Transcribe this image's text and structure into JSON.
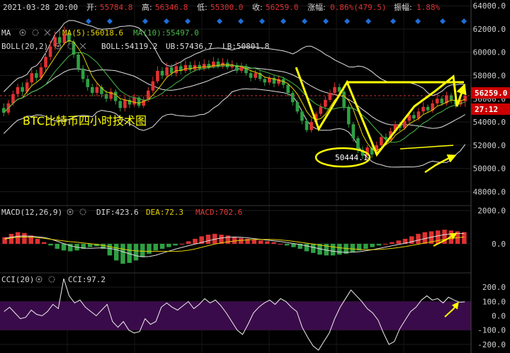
{
  "header": {
    "date": "2021-03-28 20:00",
    "open_label": "开:",
    "open": "55784.8",
    "high_label": "高:",
    "high": "56346.8",
    "low_label": "低:",
    "low": "55300.0",
    "close_label": "收:",
    "close": "56259.0",
    "change_label": "涨幅:",
    "change": "0.86%(479.5)",
    "amp_label": "振幅:",
    "amp": "1.88%"
  },
  "ma_row": {
    "name": "MA",
    "ma5": "MA(5):56018.6",
    "ma10": "MA(10):55497.0"
  },
  "boll_row": {
    "name": "BOLL(20,2)",
    "boll": "BOLL:54119.2",
    "ub": "UB:57436.7",
    "lb": "LB:50801.8"
  },
  "macd_row": {
    "name": "MACD(12,26,9)",
    "dif": "DIF:423.6",
    "dea": "DEA:72.3",
    "macd": "MACD:702.6"
  },
  "cci_row": {
    "name": "CCI(20)",
    "cci": "CCI:97.2"
  },
  "annotation": {
    "title": "BTC比特币四小时技术图",
    "low_bubble": "50444.1"
  },
  "price_tags": {
    "last": "56259.0",
    "countdown": "27:12"
  },
  "colors": {
    "up": "#e03131",
    "down": "#2ea043",
    "ma5": "#e6d200",
    "ma10": "#48b848",
    "boll": "#e0e0e0",
    "yellow": "#ffff00",
    "macd_dea": "#e53935",
    "cci_band": "#3a0b4a",
    "blue_marker": "#1e6fd9",
    "price_tag": "#cc0000"
  },
  "chart_data": [
    {
      "type": "candlestick",
      "panel": "price",
      "y_ticks": [
        "64000.0",
        "62000.0",
        "60000.0",
        "58000.0",
        "56000.0",
        "54000.0",
        "52000.0",
        "50000.0",
        "48000.0"
      ],
      "ylim": [
        46800,
        64500
      ],
      "candles": [
        [
          55200,
          54800,
          55600,
          54500
        ],
        [
          54800,
          55600,
          55900,
          54600
        ],
        [
          55600,
          56400,
          56700,
          55400
        ],
        [
          56400,
          57000,
          57300,
          56100
        ],
        [
          57000,
          56600,
          57400,
          56300
        ],
        [
          56600,
          57400,
          57700,
          56400
        ],
        [
          57400,
          58200,
          58600,
          57100
        ],
        [
          58200,
          57800,
          58500,
          57500
        ],
        [
          57800,
          58700,
          59100,
          57600
        ],
        [
          58700,
          59600,
          60100,
          58400
        ],
        [
          59600,
          60500,
          61000,
          59300
        ],
        [
          60500,
          61300,
          61800,
          60200
        ],
        [
          61300,
          60800,
          61900,
          60500
        ],
        [
          60800,
          61600,
          62200,
          60600
        ],
        [
          61600,
          60900,
          61900,
          60600
        ],
        [
          60900,
          59800,
          61100,
          59500
        ],
        [
          59800,
          58600,
          60000,
          58300
        ],
        [
          58600,
          57700,
          58900,
          57400
        ],
        [
          57700,
          57000,
          58000,
          56700
        ],
        [
          57000,
          56500,
          57300,
          56200
        ],
        [
          56500,
          57000,
          57300,
          56200
        ],
        [
          57000,
          56400,
          57200,
          56100
        ],
        [
          56400,
          56000,
          56700,
          55700
        ],
        [
          56000,
          56600,
          56900,
          55800
        ],
        [
          56600,
          55800,
          56800,
          55500
        ],
        [
          55800,
          55200,
          56000,
          54900
        ],
        [
          55200,
          55900,
          56200,
          54900
        ],
        [
          55900,
          55500,
          56100,
          55200
        ],
        [
          55500,
          56100,
          56400,
          55300
        ],
        [
          56100,
          55400,
          56300,
          55200
        ],
        [
          55400,
          55900,
          56200,
          55200
        ],
        [
          55900,
          56700,
          57000,
          55700
        ],
        [
          56700,
          57500,
          57900,
          56500
        ],
        [
          57500,
          58400,
          58800,
          57300
        ],
        [
          58400,
          58000,
          58700,
          57700
        ],
        [
          58000,
          58700,
          59100,
          57800
        ],
        [
          58700,
          58200,
          59000,
          57900
        ],
        [
          58200,
          58800,
          59200,
          57900
        ],
        [
          58800,
          58400,
          59100,
          58100
        ],
        [
          58400,
          58900,
          59300,
          58200
        ],
        [
          58900,
          58500,
          59200,
          58300
        ],
        [
          58500,
          58900,
          59300,
          58300
        ],
        [
          58900,
          58600,
          59200,
          58400
        ],
        [
          58600,
          59000,
          59400,
          58400
        ],
        [
          59000,
          58700,
          59300,
          58500
        ],
        [
          58700,
          59200,
          59600,
          58600
        ],
        [
          59200,
          58800,
          59500,
          58600
        ],
        [
          58800,
          59100,
          59500,
          58600
        ],
        [
          59100,
          58700,
          59400,
          58500
        ],
        [
          58700,
          58900,
          59300,
          58500
        ],
        [
          58900,
          58400,
          59100,
          58200
        ],
        [
          58400,
          58800,
          59100,
          58200
        ],
        [
          58800,
          58200,
          59000,
          58000
        ],
        [
          58200,
          57800,
          58400,
          57500
        ],
        [
          57800,
          58200,
          58500,
          57600
        ],
        [
          58200,
          57700,
          58400,
          57500
        ],
        [
          57700,
          57400,
          57900,
          57100
        ],
        [
          57400,
          57800,
          58000,
          57200
        ],
        [
          57800,
          57300,
          58000,
          57000
        ],
        [
          57300,
          57700,
          58000,
          57100
        ],
        [
          57700,
          57200,
          57900,
          56900
        ],
        [
          57200,
          56500,
          57300,
          56200
        ],
        [
          56500,
          55700,
          56700,
          55400
        ],
        [
          55700,
          54900,
          55900,
          54700
        ],
        [
          54900,
          54100,
          55000,
          53800
        ],
        [
          54100,
          53300,
          54300,
          53100
        ],
        [
          53300,
          54000,
          54300,
          53100
        ],
        [
          54000,
          54700,
          54900,
          53800
        ],
        [
          54700,
          55300,
          55600,
          54500
        ],
        [
          55300,
          55900,
          56200,
          55100
        ],
        [
          55900,
          56500,
          56800,
          55700
        ],
        [
          56500,
          57000,
          57400,
          56300
        ],
        [
          57000,
          56600,
          57300,
          56400
        ],
        [
          56600,
          55300,
          56800,
          55000
        ],
        [
          55300,
          53800,
          55500,
          53500
        ],
        [
          53800,
          52600,
          54000,
          52300
        ],
        [
          52600,
          51600,
          52800,
          51300
        ],
        [
          51600,
          51100,
          51900,
          50800
        ],
        [
          51100,
          51800,
          52000,
          50600
        ],
        [
          51800,
          51200,
          52100,
          50900
        ],
        [
          51200,
          52000,
          52300,
          51000
        ],
        [
          52000,
          52700,
          53000,
          51800
        ],
        [
          52700,
          52500,
          53000,
          52200
        ],
        [
          52500,
          53200,
          53500,
          52300
        ],
        [
          53200,
          53800,
          54100,
          53000
        ],
        [
          53800,
          53500,
          54000,
          53200
        ],
        [
          53500,
          54100,
          54400,
          53300
        ],
        [
          54100,
          54600,
          54900,
          53900
        ],
        [
          54600,
          54300,
          54900,
          54100
        ],
        [
          54300,
          54900,
          55200,
          54100
        ],
        [
          54900,
          55300,
          55700,
          54700
        ],
        [
          55300,
          55000,
          55500,
          54800
        ],
        [
          55000,
          55600,
          55900,
          54800
        ],
        [
          55600,
          56000,
          56400,
          55400
        ],
        [
          56000,
          55600,
          56200,
          55400
        ],
        [
          55600,
          56300,
          56600,
          55400
        ],
        [
          56300,
          55900,
          56500,
          55600
        ],
        [
          55900,
          55500,
          56100,
          55200
        ],
        [
          55500,
          55800,
          56346.8,
          55300
        ],
        [
          55784.8,
          56259,
          56346.8,
          55300
        ]
      ],
      "markers": [
        "57436.7 (UB)",
        "50801.8 (LB)"
      ]
    },
    {
      "type": "bar",
      "panel": "macd",
      "y_ticks": [
        "2000.0",
        "0.0"
      ],
      "ylim": [
        -1750,
        2300
      ],
      "macd_hist": [
        400,
        600,
        700,
        650,
        500,
        300,
        100,
        -100,
        -300,
        -400,
        -450,
        -400,
        -300,
        -200,
        -150,
        -300,
        -700,
        -1000,
        -1200,
        -1150,
        -1000,
        -800,
        -600,
        -400,
        -300,
        -200,
        -100,
        0,
        150,
        300,
        450,
        550,
        600,
        550,
        500,
        400,
        350,
        300,
        250,
        200,
        150,
        100,
        0,
        -100,
        -200,
        -300,
        -450,
        -550,
        -650,
        -700,
        -700,
        -650,
        -600,
        -500,
        -400,
        -300,
        -200,
        -100,
        0,
        100,
        200,
        300,
        450,
        600,
        700,
        750,
        800,
        850,
        800,
        750,
        702.6
      ],
      "dif_line": "DIF:423.6",
      "dea_line": "DEA:72.3"
    },
    {
      "type": "line",
      "panel": "cci",
      "y_ticks": [
        "200.0",
        "100.0",
        "0.0",
        "-100.0",
        "-200.0"
      ],
      "ylim": [
        -260,
        300
      ],
      "cci": [
        30,
        60,
        20,
        -20,
        -10,
        40,
        10,
        0,
        30,
        80,
        50,
        260,
        140,
        90,
        110,
        60,
        30,
        0,
        40,
        80,
        -40,
        -80,
        -40,
        -100,
        -120,
        -110,
        -20,
        -60,
        -40,
        60,
        90,
        60,
        40,
        70,
        100,
        50,
        80,
        120,
        90,
        110,
        70,
        20,
        -40,
        -100,
        -130,
        -60,
        20,
        60,
        90,
        110,
        80,
        120,
        100,
        60,
        30,
        -80,
        -150,
        -210,
        -240,
        -180,
        -120,
        -20,
        60,
        120,
        180,
        140,
        100,
        50,
        20,
        -30,
        -120,
        -200,
        -180,
        -90,
        -30,
        30,
        60,
        110,
        140,
        110,
        120,
        90,
        130,
        110,
        95,
        97.2
      ]
    }
  ]
}
